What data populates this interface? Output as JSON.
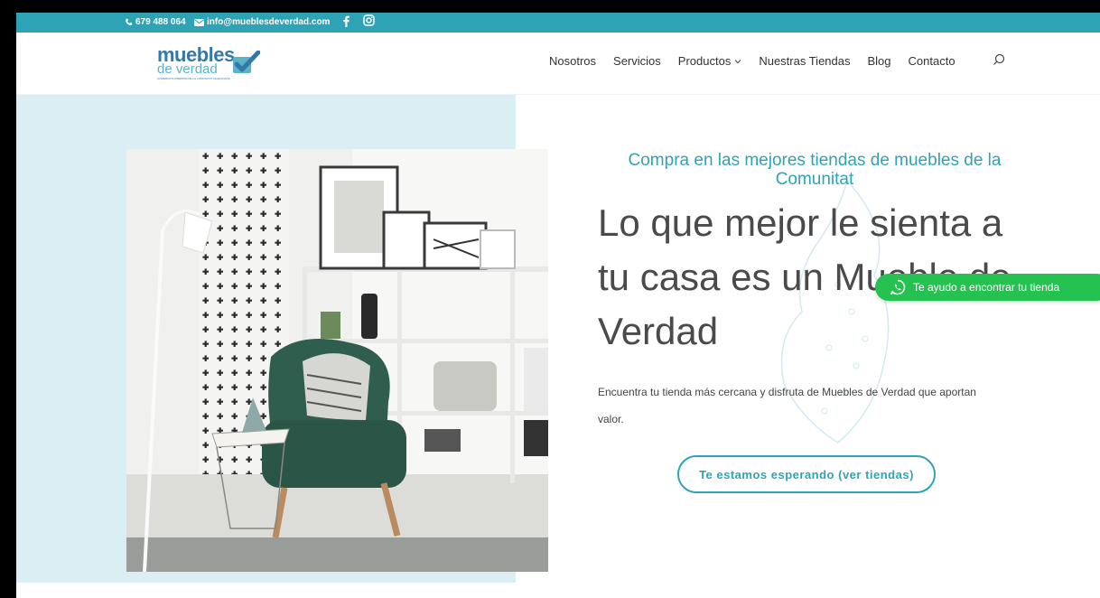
{
  "topbar": {
    "phone": "679 488 064",
    "email": "info@mueblesdeverdad.com",
    "facebook_icon": "facebook-icon",
    "instagram_icon": "instagram-icon",
    "color": "#2ea3b5"
  },
  "logo": {
    "line1": "muebles",
    "line2": "de verdad",
    "tagline": "COMERCIOS PREMIUM DE LA COMUNITAT VALENCIANA"
  },
  "nav": {
    "items": [
      "Nosotros",
      "Servicios",
      "Productos",
      "Nuestras Tiendas",
      "Blog",
      "Contacto"
    ],
    "search_icon": "search-icon"
  },
  "hero": {
    "kicker": "Compra en las mejores tiendas de muebles de la Comunitat",
    "headline": "Lo que mejor le sienta a tu casa es un Mueble de Verdad",
    "description": "Encuentra tu tienda más cercana y disfruta de Muebles de Verdad que aportan valor.",
    "cta": "Te estamos esperando (ver tiendas)"
  },
  "whatsapp": {
    "label": "Te ayudo a encontrar tu tienda",
    "color": "#25c251"
  }
}
